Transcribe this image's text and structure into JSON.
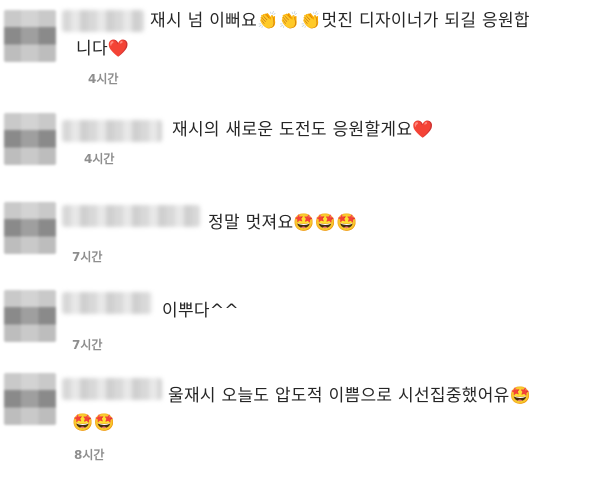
{
  "comments": [
    {
      "text_line1": "재시 넘 이뻐요👏👏👏멋진 디자이너가 되길 응원합",
      "text_line2": "니다❤️",
      "time": "4시간"
    },
    {
      "text_line1": "재시의 새로운 도전도 응원할게요❤️",
      "time": "4시간"
    },
    {
      "text_line1": "정말 멋져요🤩🤩🤩",
      "time": "7시간"
    },
    {
      "text_line1": "이뿌다^^",
      "time": "7시간"
    },
    {
      "text_line1": "울재시 오늘도 압도적 이쁨으로 시선집중했어유🤩",
      "text_line2": "🤩🤩",
      "time": "8시간"
    }
  ]
}
